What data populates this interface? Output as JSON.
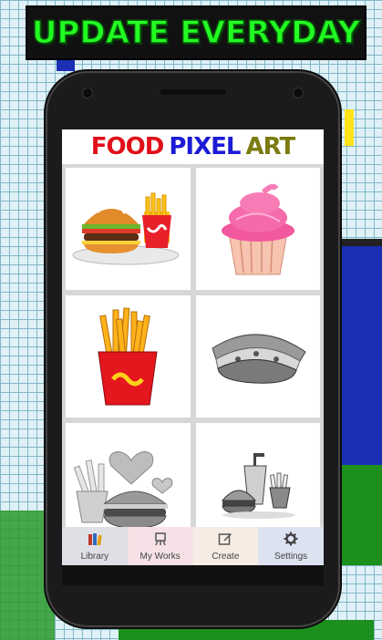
{
  "banner": {
    "text": "UPDATE EVERYDAY"
  },
  "app": {
    "title_words": [
      {
        "text": "FOOD",
        "color": "#e0101a"
      },
      {
        "text": "PIXEL",
        "color": "#1b1bd6"
      },
      {
        "text": "ART",
        "color": "#7b7b10"
      }
    ]
  },
  "gallery": {
    "tiles": [
      {
        "icon": "burger-fries-drink-icon"
      },
      {
        "icon": "cupcake-icon"
      },
      {
        "icon": "french-fries-icon"
      },
      {
        "icon": "sandwich-icon"
      },
      {
        "icon": "burger-hearts-icon"
      },
      {
        "icon": "fastfood-combo-icon"
      }
    ]
  },
  "tabs": [
    {
      "label": "Library",
      "icon": "books-icon",
      "bg": "#dfe0e6"
    },
    {
      "label": "My Works",
      "icon": "easel-icon",
      "bg": "#f6e2e6"
    },
    {
      "label": "Create",
      "icon": "edit-icon",
      "bg": "#f6ece4"
    },
    {
      "label": "Settings",
      "icon": "gear-icon",
      "bg": "#dce2f0"
    }
  ]
}
